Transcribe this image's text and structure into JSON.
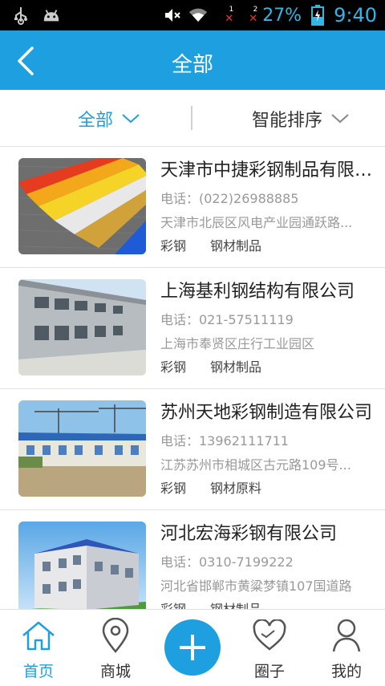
{
  "status_bar": {
    "battery_percent": "27%",
    "time": "9:40",
    "sim1_label": "1",
    "sim2_label": "2",
    "icons": [
      "usb-icon",
      "android-icon",
      "mute-icon",
      "wifi-icon",
      "signal-icon",
      "battery-charging-icon"
    ]
  },
  "header": {
    "title": "全部",
    "back_icon": "chevron-left-icon"
  },
  "filters": {
    "category_label": "全部",
    "sort_label": "智能排序"
  },
  "companies": [
    {
      "name": "天津市中捷彩钢制品有限公司",
      "phone": "电话：(022)26988885",
      "address": "天津市北辰区风电产业园通跃路...",
      "tags": [
        "彩钢",
        "钢材制品"
      ]
    },
    {
      "name": "上海基利钢结构有限公司",
      "phone": "电话：021-57511119",
      "address": "上海市奉贤区庄行工业园区",
      "tags": [
        "彩钢",
        "钢材制品"
      ]
    },
    {
      "name": "苏州天地彩钢制造有限公司",
      "phone": "电话：13962111711",
      "address": "江苏苏州市相城区古元路109号...",
      "tags": [
        "彩钢",
        "钢材原料"
      ]
    },
    {
      "name": "河北宏海彩钢有限公司",
      "phone": "电话：0310-7199222",
      "address": "河北省邯郸市黄粱梦镇107国道路",
      "tags": [
        "彩钢",
        "钢材制品"
      ]
    }
  ],
  "bottom_nav": {
    "home": "首页",
    "mall": "商城",
    "circle": "圈子",
    "mine": "我的"
  },
  "colors": {
    "accent": "#1e9fe0",
    "status_text": "#33b5e5"
  }
}
